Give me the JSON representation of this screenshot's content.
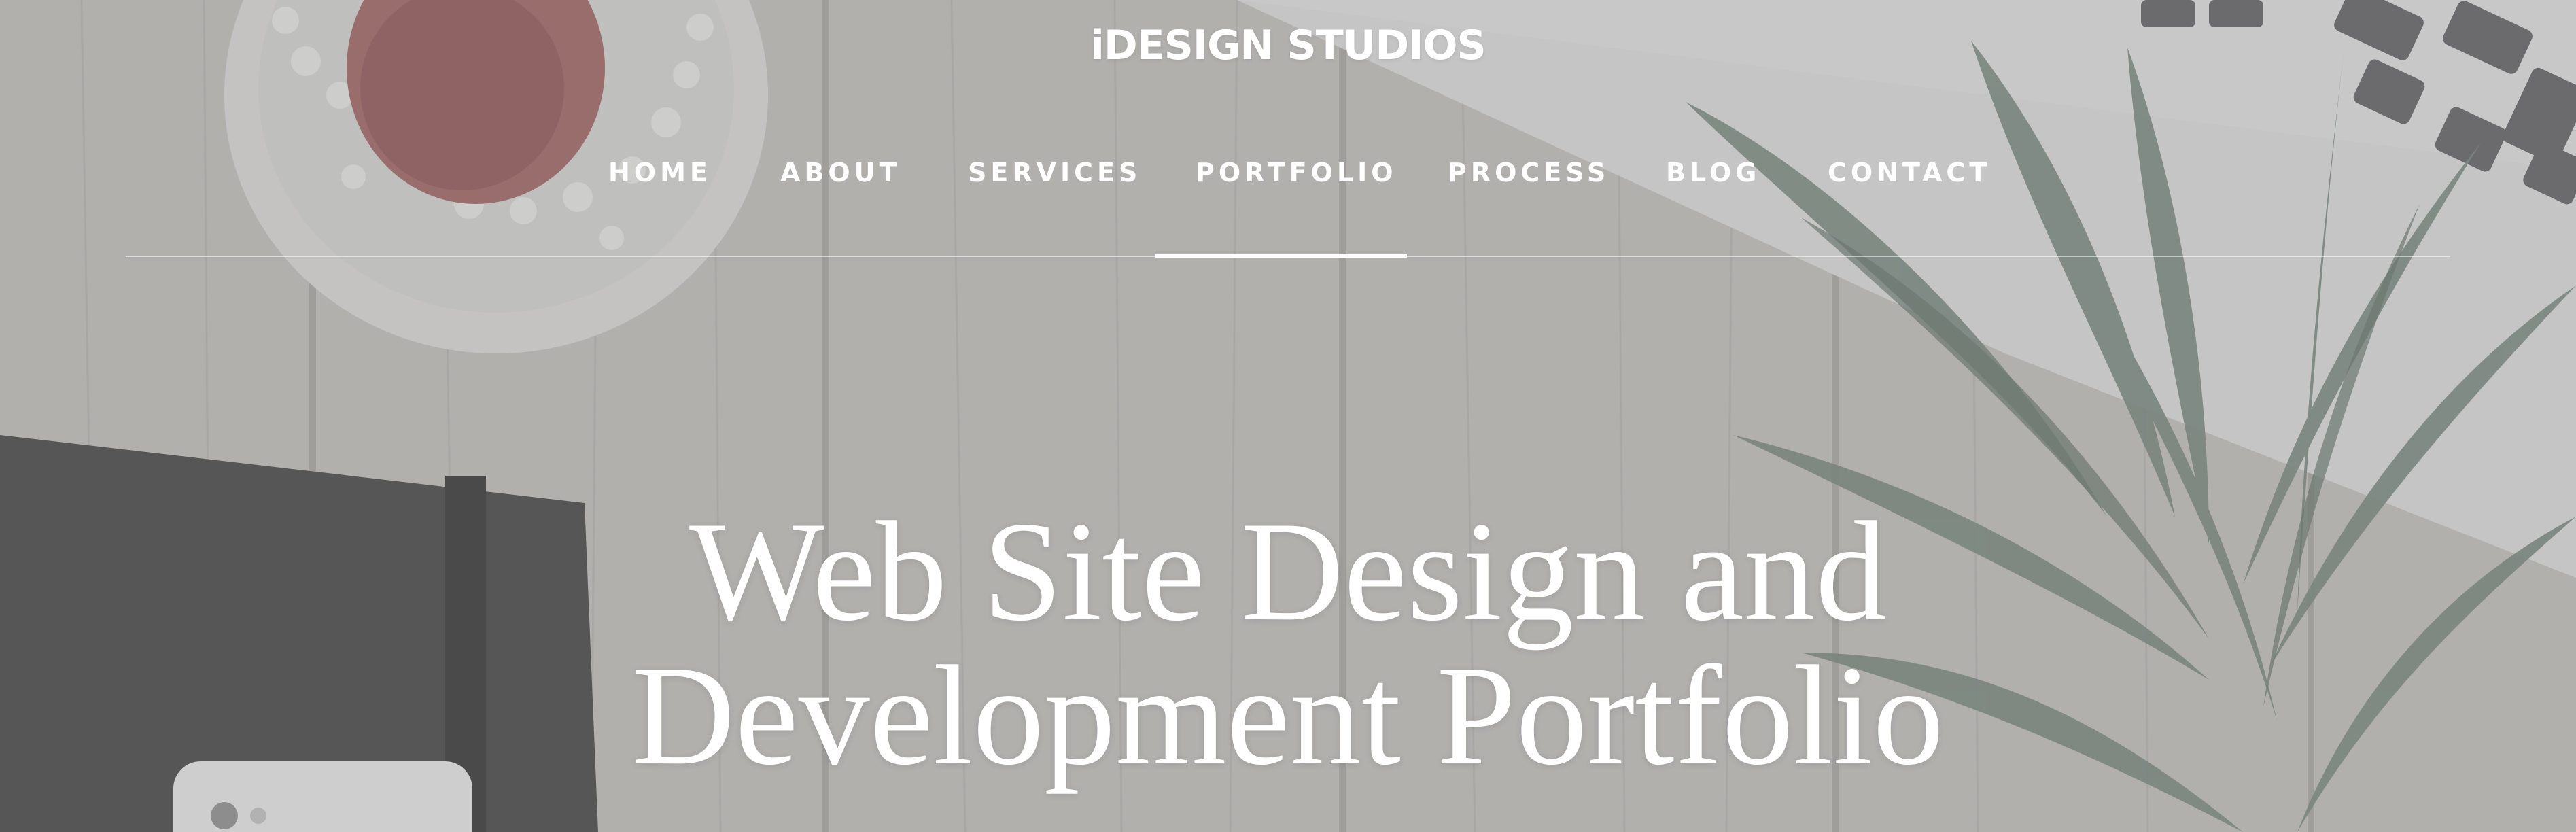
{
  "header": {
    "brand": "iDESIGN STUDIOS"
  },
  "nav": {
    "items": [
      {
        "label": "HOME"
      },
      {
        "label": "ABOUT"
      },
      {
        "label": "SERVICES"
      },
      {
        "label": "PORTFOLIO"
      },
      {
        "label": "PROCESS"
      },
      {
        "label": "BLOG"
      },
      {
        "label": "CONTACT"
      }
    ],
    "active": "PORTFOLIO"
  },
  "hero": {
    "headline_line1": "Web Site Design and",
    "headline_line2": "Development Portfolio"
  },
  "colors": {
    "text": "#ffffff",
    "overlay": "#9a9a9a"
  }
}
